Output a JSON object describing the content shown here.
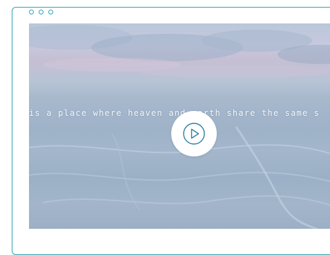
{
  "window": {
    "controls": [
      "window-dot-1",
      "window-dot-2",
      "window-dot-3"
    ]
  },
  "video": {
    "caption": "is a place where heaven and earth share the same s",
    "play_icon": "play-icon"
  },
  "colors": {
    "accent": "#2aa3b3",
    "play_button": "#ffffff",
    "caption_text": "#f4f6fa"
  }
}
